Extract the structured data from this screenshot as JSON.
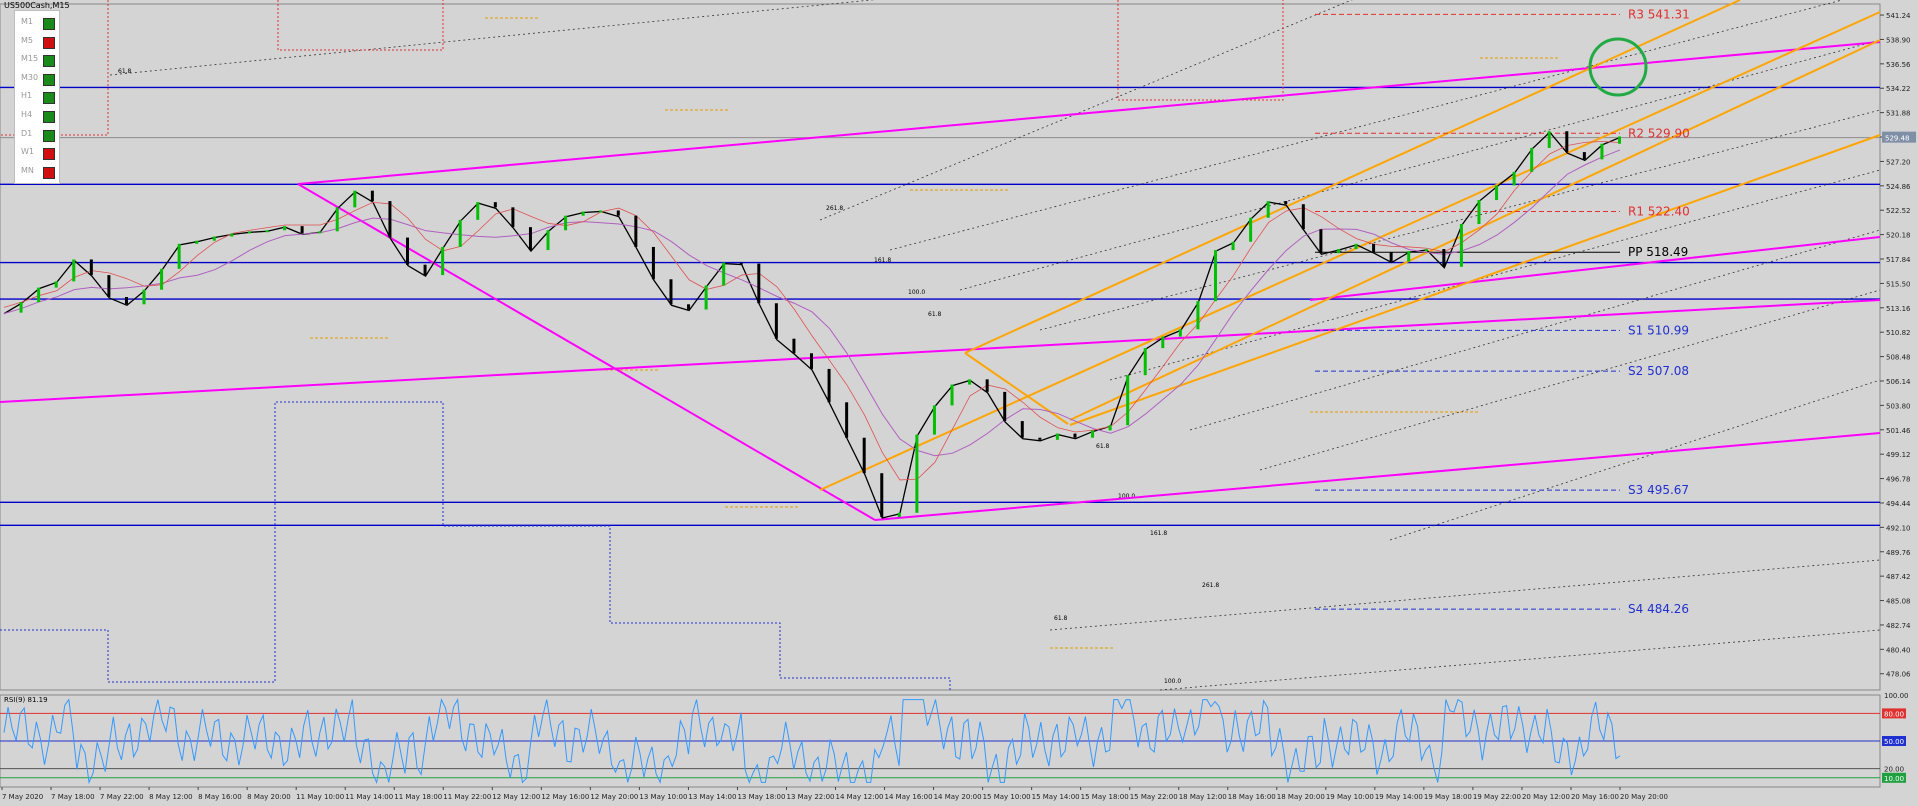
{
  "symbol_label": "US500Cash,M15",
  "timeframes": [
    {
      "label": "M1",
      "status": "green"
    },
    {
      "label": "M5",
      "status": "red"
    },
    {
      "label": "M15",
      "status": "green"
    },
    {
      "label": "M30",
      "status": "green"
    },
    {
      "label": "H1",
      "status": "green"
    },
    {
      "label": "H4",
      "status": "green"
    },
    {
      "label": "D1",
      "status": "green"
    },
    {
      "label": "W1",
      "status": "red"
    },
    {
      "label": "MN",
      "status": "red"
    }
  ],
  "colors": {
    "background": "#d4d4d4",
    "grid": "#9a9a9a",
    "up": "#00c000",
    "down": "#000000",
    "trendline": "#ff00ff",
    "channel": "#ffa500",
    "horizontal": "#0000cc",
    "resistance": "#e03030",
    "support": "#2030d0",
    "pivot": "#000000",
    "rsi": "#3399ff",
    "highlight_circle": "#22aa44"
  },
  "chart_data": {
    "type": "line",
    "price_axis": {
      "ylim": [
        476.5,
        542.3
      ],
      "ticks": [
        "541.24",
        "538.90",
        "536.56",
        "534.22",
        "531.88",
        "529.54",
        "527.20",
        "524.86",
        "522.52",
        "520.18",
        "517.84",
        "515.50",
        "513.16",
        "510.82",
        "508.48",
        "506.14",
        "503.80",
        "501.46",
        "499.12",
        "496.78",
        "494.44",
        "492.10",
        "489.76",
        "487.42",
        "485.08",
        "482.74",
        "480.40",
        "478.06"
      ],
      "current_price": "529.48"
    },
    "time_axis": {
      "labels": [
        "7 May 2020",
        "7 May 18:00",
        "7 May 22:00",
        "8 May 12:00",
        "8 May 16:00",
        "8 May 20:00",
        "11 May 10:00",
        "11 May 14:00",
        "11 May 18:00",
        "11 May 22:00",
        "12 May 12:00",
        "12 May 16:00",
        "12 May 20:00",
        "13 May 10:00",
        "13 May 14:00",
        "13 May 18:00",
        "13 May 22:00",
        "14 May 12:00",
        "14 May 16:00",
        "14 May 20:00",
        "15 May 10:00",
        "15 May 14:00",
        "15 May 18:00",
        "15 May 22:00",
        "18 May 12:00",
        "18 May 16:00",
        "18 May 20:00",
        "19 May 10:00",
        "19 May 14:00",
        "19 May 18:00",
        "19 May 22:00",
        "20 May 12:00",
        "20 May 16:00",
        "20 May 20:00"
      ]
    },
    "price_series": {
      "name": "",
      "values": [
        512.6,
        513.6,
        515.0,
        515.6,
        517.7,
        516.2,
        514.1,
        513.4,
        514.8,
        516.8,
        519.2,
        519.5,
        519.9,
        520.2,
        520.4,
        520.5,
        520.9,
        520.2,
        520.4,
        522.7,
        524.3,
        523.3,
        519.8,
        517.2,
        516.2,
        518.9,
        521.5,
        523.2,
        522.7,
        520.8,
        518.6,
        520.5,
        521.9,
        522.3,
        522.4,
        521.9,
        518.9,
        515.8,
        513.4,
        512.9,
        515.2,
        517.4,
        517.3,
        513.5,
        510.1,
        508.7,
        507.2,
        504.0,
        500.6,
        497.2,
        493.0,
        493.4,
        500.9,
        503.7,
        505.7,
        506.2,
        505.0,
        502.2,
        500.6,
        500.4,
        501.0,
        500.6,
        501.3,
        501.8,
        506.6,
        509.2,
        510.3,
        511.0,
        513.7,
        518.6,
        519.4,
        521.7,
        523.3,
        523.0,
        520.6,
        518.3,
        518.7,
        519.2,
        518.4,
        517.5,
        518.5,
        518.7,
        517.0,
        521.1,
        523.4,
        524.8,
        526.1,
        528.4,
        530.0,
        528.0,
        527.3,
        528.8,
        529.5
      ]
    },
    "rsi": {
      "title": "RSI(9) 81.19",
      "ylim": [
        0,
        100
      ],
      "ticks": [
        "100.00",
        "80.00",
        "50.00",
        "20.00",
        "10.00"
      ]
    },
    "pivots": [
      {
        "label": "R3 541.31",
        "value": 541.31,
        "kind": "resistance"
      },
      {
        "label": "R2 529.90",
        "value": 529.9,
        "kind": "resistance"
      },
      {
        "label": "R1 522.40",
        "value": 522.4,
        "kind": "resistance"
      },
      {
        "label": "PP 518.49",
        "value": 518.49,
        "kind": "pivot"
      },
      {
        "label": "S1 510.99",
        "value": 510.99,
        "kind": "support"
      },
      {
        "label": "S2 507.08",
        "value": 507.08,
        "kind": "support"
      },
      {
        "label": "S3 495.67",
        "value": 495.67,
        "kind": "support"
      },
      {
        "label": "S4 484.26",
        "value": 484.26,
        "kind": "support"
      }
    ],
    "horizontal_lines": [
      534.3,
      525.0,
      517.5,
      514.0,
      494.5,
      492.3
    ],
    "fib_labels": [
      "61.8",
      "261.8",
      "161.8",
      "100.0",
      "61.8",
      "61.8",
      "100.0",
      "161.8",
      "261.8",
      "61.8",
      "100.0"
    ]
  }
}
